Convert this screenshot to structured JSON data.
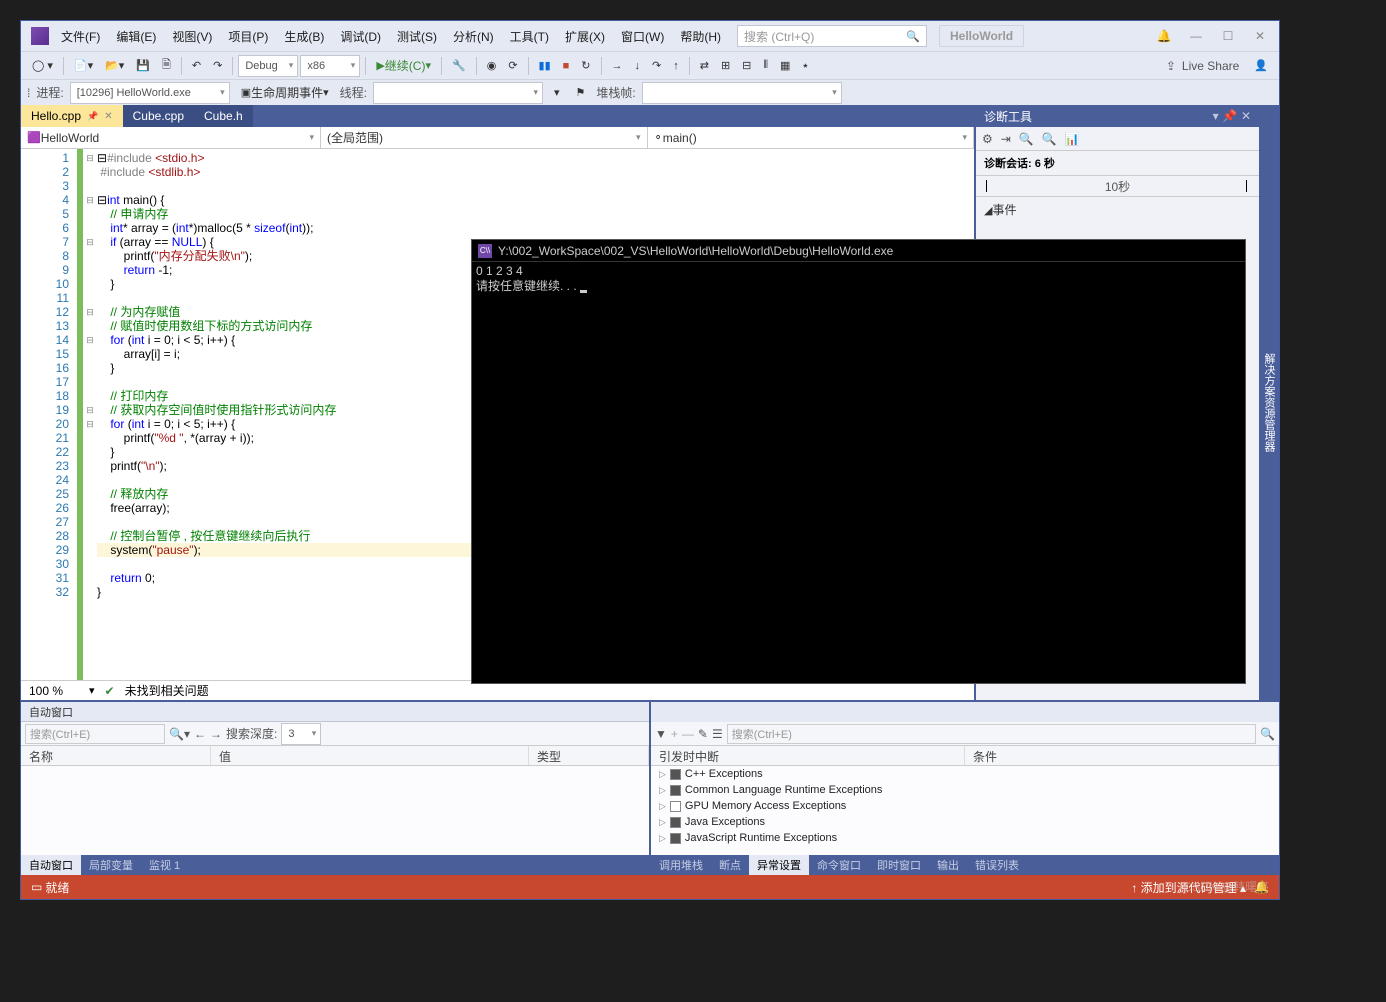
{
  "menu": [
    "文件(F)",
    "编辑(E)",
    "视图(V)",
    "项目(P)",
    "生成(B)",
    "调试(D)",
    "测试(S)",
    "分析(N)",
    "工具(T)",
    "扩展(X)",
    "窗口(W)",
    "帮助(H)"
  ],
  "search_placeholder": "搜索 (Ctrl+Q)",
  "project_name": "HelloWorld",
  "toolbar": {
    "config": "Debug",
    "platform": "x86",
    "continue": "继续(C)",
    "live_share": "Live Share"
  },
  "toolbar2": {
    "process_label": "进程:",
    "process": "[10296] HelloWorld.exe",
    "lifecycle": "生命周期事件",
    "thread_label": "线程:",
    "stackframe_label": "堆栈帧:"
  },
  "tabs": [
    {
      "name": "Hello.cpp",
      "active": true,
      "pinned": true
    },
    {
      "name": "Cube.cpp",
      "active": false
    },
    {
      "name": "Cube.h",
      "active": false
    }
  ],
  "nav": {
    "scope1": "HelloWorld",
    "scope2": "(全局范围)",
    "scope3": "main()"
  },
  "code_lines": 32,
  "zoom": "100 %",
  "no_issues": "未找到相关问题",
  "diag": {
    "title": "诊断工具",
    "session": "诊断会话: 6 秒",
    "ruler_mark": "10秒",
    "events": "事件"
  },
  "side_tab": "解决方案资源管理器",
  "console": {
    "title": "Y:\\002_WorkSpace\\002_VS\\HelloWorld\\HelloWorld\\Debug\\HelloWorld.exe",
    "line1": "0 1 2 3 4",
    "line2": "请按任意键继续. . . "
  },
  "auto_panel": {
    "title": "自动窗口",
    "search": "搜索(Ctrl+E)",
    "depth_label": "搜索深度:",
    "cols": [
      "名称",
      "值",
      "类型"
    ]
  },
  "exc_panel": {
    "search": "搜索(Ctrl+E)",
    "cols": [
      "引发时中断",
      "条件"
    ],
    "rows": [
      {
        "label": "C++ Exceptions",
        "checked": true
      },
      {
        "label": "Common Language Runtime Exceptions",
        "checked": true
      },
      {
        "label": "GPU Memory Access Exceptions",
        "checked": false
      },
      {
        "label": "Java Exceptions",
        "checked": true
      },
      {
        "label": "JavaScript Runtime Exceptions",
        "checked": true
      }
    ]
  },
  "bottom_tabs_left": [
    "自动窗口",
    "局部变量",
    "监视 1"
  ],
  "bottom_tabs_right": [
    "调用堆栈",
    "断点",
    "异常设置",
    "命令窗口",
    "即时窗口",
    "输出",
    "错误列表"
  ],
  "status": {
    "text": "就绪",
    "scm": "添加到源代码管理"
  },
  "watermark": "CSDN @韩曙亮"
}
